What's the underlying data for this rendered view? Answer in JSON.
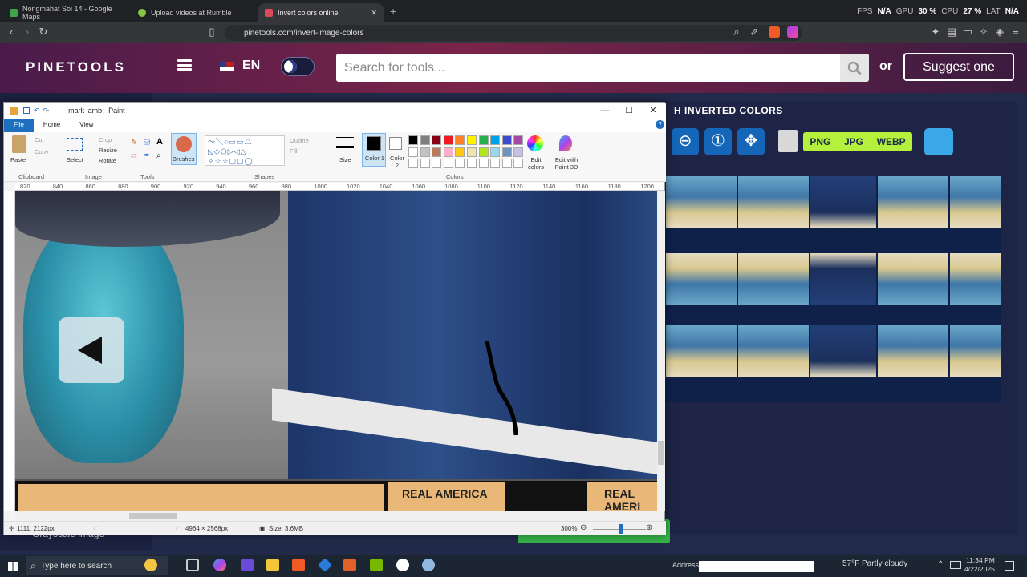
{
  "browser": {
    "tabs": [
      {
        "title": "Nongmahat Soi 14 - Google Maps",
        "icon": "maps-pin-icon",
        "active": false
      },
      {
        "title": "Upload videos at Rumble",
        "icon": "rumble-icon",
        "active": false
      },
      {
        "title": "Invert colors online",
        "icon": "pinetools-icon",
        "active": true
      }
    ],
    "new_tab": "+",
    "url": "pinetools.com/invert-image-colors",
    "overlay": {
      "fps_label": "FPS",
      "fps": "N/A",
      "gpu_label": "GPU",
      "gpu": "30 %",
      "cpu_label": "CPU",
      "cpu": "27 %",
      "lat_label": "LAT",
      "lat": "N/A"
    }
  },
  "site": {
    "logo": "PINETOOLS",
    "lang": "EN",
    "search_placeholder": "Search for tools...",
    "or": "or",
    "suggest": "Suggest one",
    "panel_title": "H INVERTED COLORS",
    "formats": [
      "PNG",
      "JPG",
      "WEBP"
    ],
    "sidebar_item": "Grayscale image",
    "colors": {
      "accent": "#b5f03c",
      "zoom": "#1566b8",
      "header": "#7a2448"
    }
  },
  "paint": {
    "title": "mark lamb - Paint",
    "tabs": [
      "File",
      "Home",
      "View"
    ],
    "clipboard": {
      "paste": "Paste",
      "cut": "Cut",
      "copy": "Copy",
      "label": "Clipboard"
    },
    "image": {
      "select": "Select",
      "crop": "Crop",
      "resize": "Resize",
      "rotate": "Rotate",
      "label": "Image"
    },
    "tools_label": "Tools",
    "brushes": "Brushes",
    "shapes": {
      "outline": "Outline",
      "fill": "Fill",
      "label": "Shapes"
    },
    "size": "Size",
    "color1": "Color 1",
    "color2": "Color 2",
    "colors_label": "Colors",
    "edit_colors": "Edit colors",
    "edit_paint3d": "Edit with Paint 3D",
    "ruler": [
      "820",
      "840",
      "860",
      "880",
      "900",
      "920",
      "940",
      "960",
      "980",
      "1000",
      "1020",
      "1040",
      "1060",
      "1080",
      "1100",
      "1120",
      "1140",
      "1160",
      "1180",
      "1200"
    ],
    "palette": [
      "#000000",
      "#7f7f7f",
      "#880015",
      "#ed1c24",
      "#ff7f27",
      "#fff200",
      "#22b14c",
      "#00a2e8",
      "#3f48cc",
      "#a349a4",
      "#ffffff",
      "#c3c3c3",
      "#b97a57",
      "#ffaec9",
      "#ffc90e",
      "#efe4b0",
      "#b5e61d",
      "#99d9ea",
      "#7092be",
      "#c8bfe7"
    ],
    "canvas_text": {
      "banner1": "REAL AMERICA",
      "banner2": "REAL AMERI"
    },
    "status": {
      "cursor": "1111, 2122px",
      "dims": "4964 × 2568px",
      "size": "Size: 3.6MB",
      "zoom": "300%"
    }
  },
  "taskbar": {
    "search": "Type here to search",
    "address_label": "Address",
    "weather": "57°F  Partly cloudy",
    "time": "11:34 PM",
    "date": "4/22/2025"
  }
}
